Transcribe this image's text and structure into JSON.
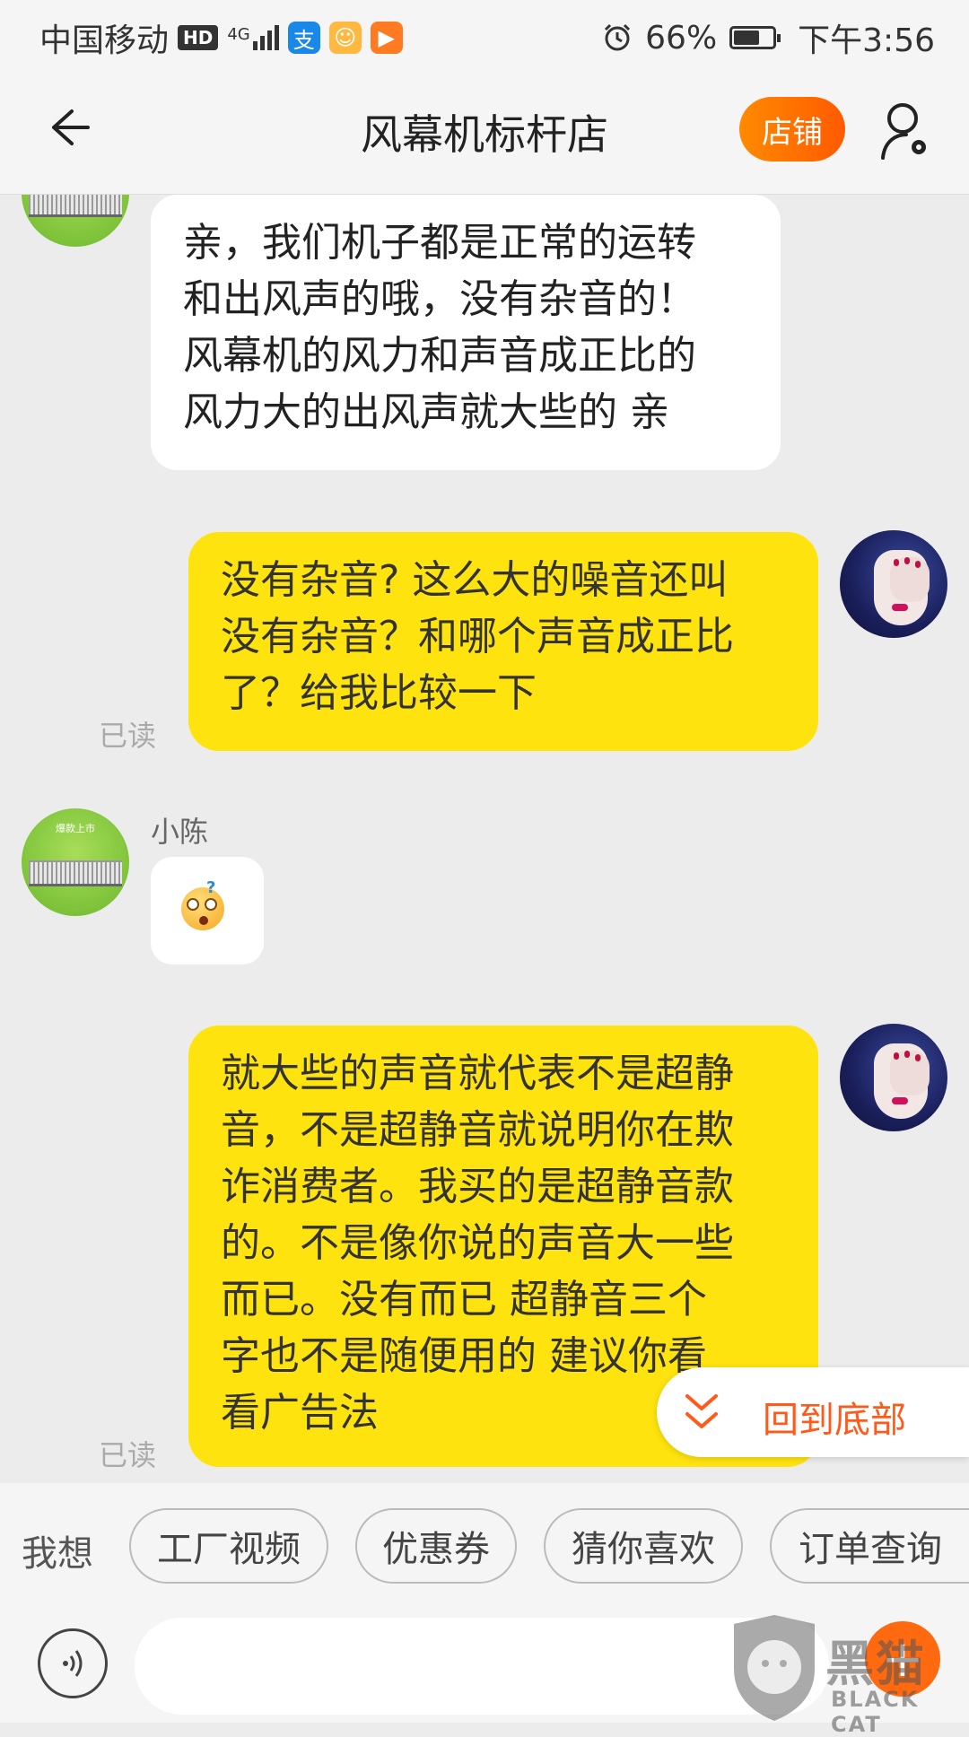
{
  "status_bar": {
    "carrier": "中国移动",
    "hd_badge": "HD",
    "network": "4G",
    "battery_percent_text": "66%",
    "battery_level": 0.66,
    "time": "下午3:56"
  },
  "header": {
    "title": "风幕机标杆店",
    "shop_button": "店铺"
  },
  "messages": [
    {
      "from": "shop",
      "text": "亲，我们机子都是正常的运转\n和出风声的哦，没有杂音的！\n风幕机的风力和声音成正比的\n风力大的出风声就大些的 亲"
    },
    {
      "from": "user",
      "status": "已读",
      "text": "没有杂音? 这么大的噪音还叫\n没有杂音？和哪个声音成正比\n了？给我比较一下"
    },
    {
      "from": "shop",
      "sender": "小陈",
      "avatar_sign": "爆款上市",
      "type": "emoji"
    },
    {
      "from": "user",
      "status": "已读",
      "text": "就大些的声音就代表不是超静\n音，不是超静音就说明你在欺\n诈消费者。我买的是超静音款\n的。不是像你说的声音大一些\n而已。没有而已  超静音三个\n字也不是随便用的  建议你看\n看广告法"
    }
  ],
  "back_to_bottom": "回到底部",
  "quick_replies": {
    "prefix": "我想",
    "items": [
      "工厂视频",
      "优惠券",
      "猜你喜欢",
      "订单查询"
    ]
  },
  "input": {
    "placeholder": ""
  },
  "watermark": {
    "text": "黑猫",
    "sub": "BLACK CAT"
  },
  "colors": {
    "accent": "#ff6a00",
    "user_bubble": "#ffe30e",
    "shop_bubble": "#ffffff"
  }
}
